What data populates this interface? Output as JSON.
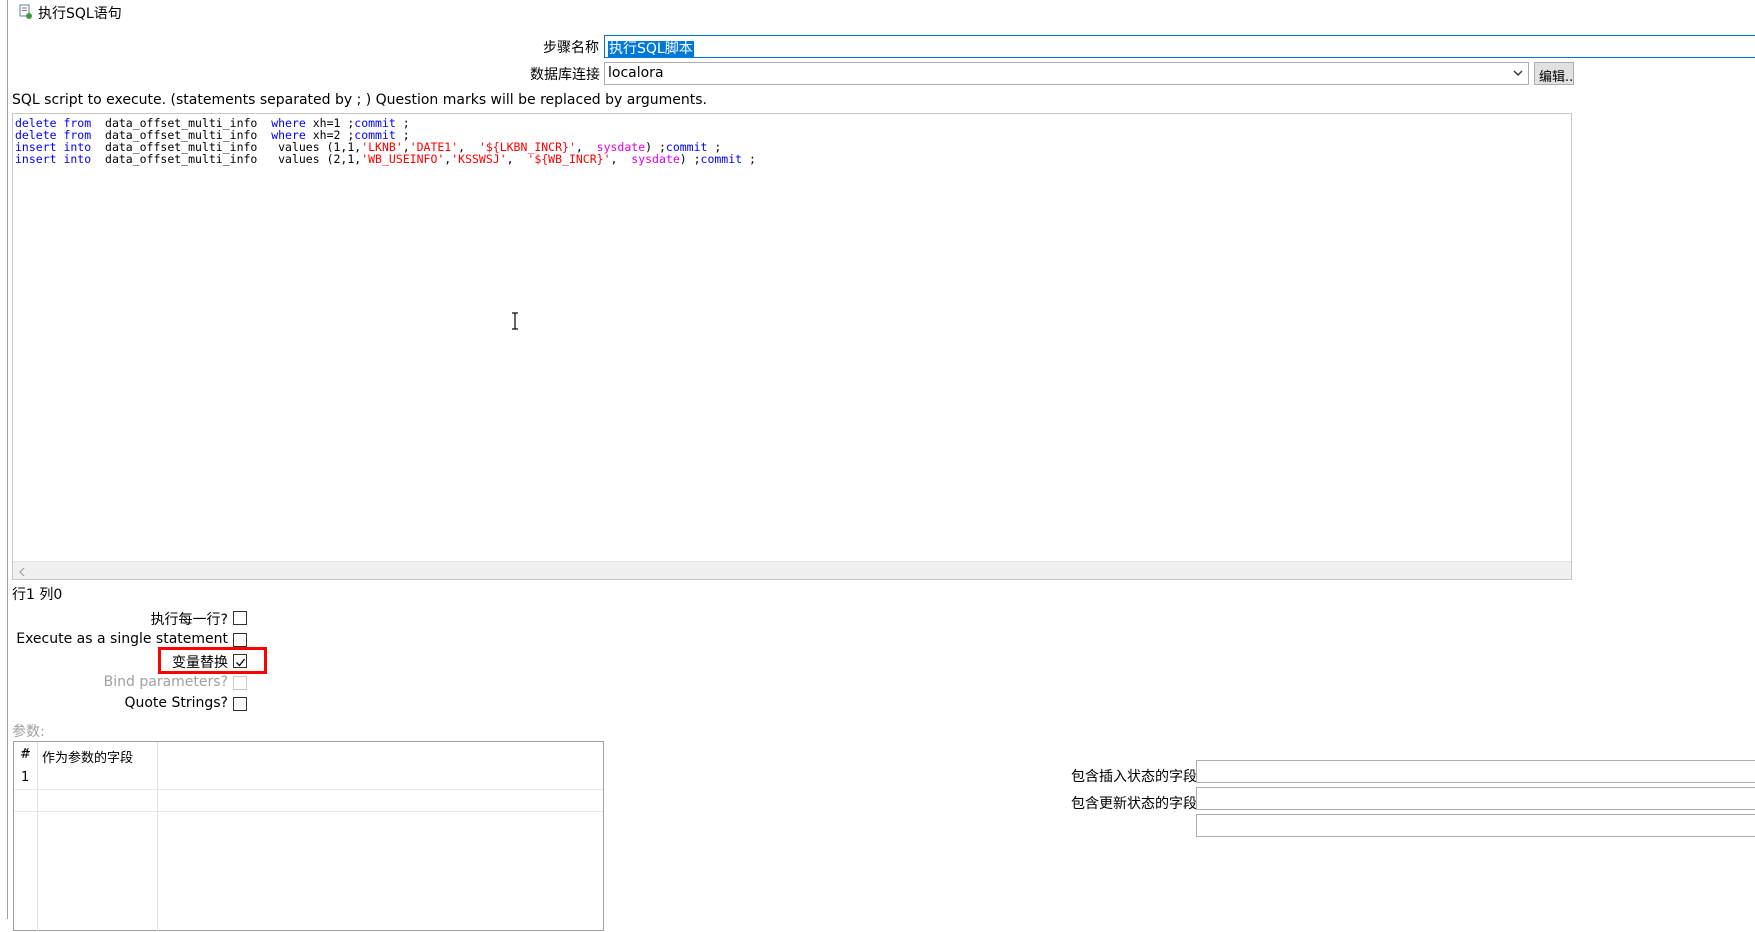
{
  "window": {
    "title": "执行SQL语句",
    "icon": "sql-script-icon"
  },
  "step_name": {
    "label": "步骤名称",
    "value": "执行SQL脚本"
  },
  "db_connection": {
    "label": "数据库连接",
    "value": "localora",
    "edit_button": "编辑..."
  },
  "script_hint": "SQL script to execute. (statements separated by ; ) Question marks will be replaced by arguments.",
  "sql_lines": [
    [
      {
        "t": "delete from",
        "c": "kw"
      },
      {
        "t": "  data_offset_multi_info  ",
        "c": "plain"
      },
      {
        "t": "where",
        "c": "kw"
      },
      {
        "t": " xh=1 ;",
        "c": "plain"
      },
      {
        "t": "commit",
        "c": "kw"
      },
      {
        "t": " ;",
        "c": "plain"
      }
    ],
    [
      {
        "t": "delete from",
        "c": "kw"
      },
      {
        "t": "  data_offset_multi_info  ",
        "c": "plain"
      },
      {
        "t": "where",
        "c": "kw"
      },
      {
        "t": " xh=2 ;",
        "c": "plain"
      },
      {
        "t": "commit",
        "c": "kw"
      },
      {
        "t": " ;",
        "c": "plain"
      }
    ],
    [
      {
        "t": "insert into",
        "c": "kw"
      },
      {
        "t": "  data_offset_multi_info   values (1,1,",
        "c": "plain"
      },
      {
        "t": "'LKNB'",
        "c": "str"
      },
      {
        "t": ",",
        "c": "plain"
      },
      {
        "t": "'DATE1'",
        "c": "str"
      },
      {
        "t": ",  ",
        "c": "plain"
      },
      {
        "t": "'${LKBN_INCR}'",
        "c": "str"
      },
      {
        "t": ",  ",
        "c": "plain"
      },
      {
        "t": "sysdate",
        "c": "fn"
      },
      {
        "t": ") ;",
        "c": "plain"
      },
      {
        "t": "commit",
        "c": "kw"
      },
      {
        "t": " ;",
        "c": "plain"
      }
    ],
    [
      {
        "t": "insert into",
        "c": "kw"
      },
      {
        "t": "  data_offset_multi_info   values (2,1,",
        "c": "plain"
      },
      {
        "t": "'WB_USEINFO'",
        "c": "str"
      },
      {
        "t": ",",
        "c": "plain"
      },
      {
        "t": "'KSSWSJ'",
        "c": "str"
      },
      {
        "t": ",  ",
        "c": "plain"
      },
      {
        "t": "'${WB_INCR}'",
        "c": "str"
      },
      {
        "t": ",  ",
        "c": "plain"
      },
      {
        "t": "sysdate",
        "c": "fn"
      },
      {
        "t": ") ;",
        "c": "plain"
      },
      {
        "t": "commit",
        "c": "kw"
      },
      {
        "t": " ;",
        "c": "plain"
      }
    ]
  ],
  "cursor_pos": "行1 列0",
  "options": {
    "each_row": {
      "label": "执行每一行?",
      "checked": false
    },
    "single_statement": {
      "label": "Execute as a single statement",
      "checked": false
    },
    "variable_substitution": {
      "label": "变量替换",
      "checked": true
    },
    "bind_parameters": {
      "label": "Bind parameters?",
      "checked": false,
      "disabled": true
    },
    "quote_strings": {
      "label": "Quote Strings?",
      "checked": false
    }
  },
  "params": {
    "label": "参数:",
    "columns": [
      "#",
      "作为参数的字段"
    ],
    "rows": [
      [
        "1",
        ""
      ]
    ]
  },
  "status_fields": {
    "insert": {
      "label": "包含插入状态的字段",
      "value": ""
    },
    "update": {
      "label": "包含更新状态的字段",
      "value": ""
    }
  },
  "colors": {
    "highlight": "#ff0000",
    "selection": "#0078d7"
  }
}
